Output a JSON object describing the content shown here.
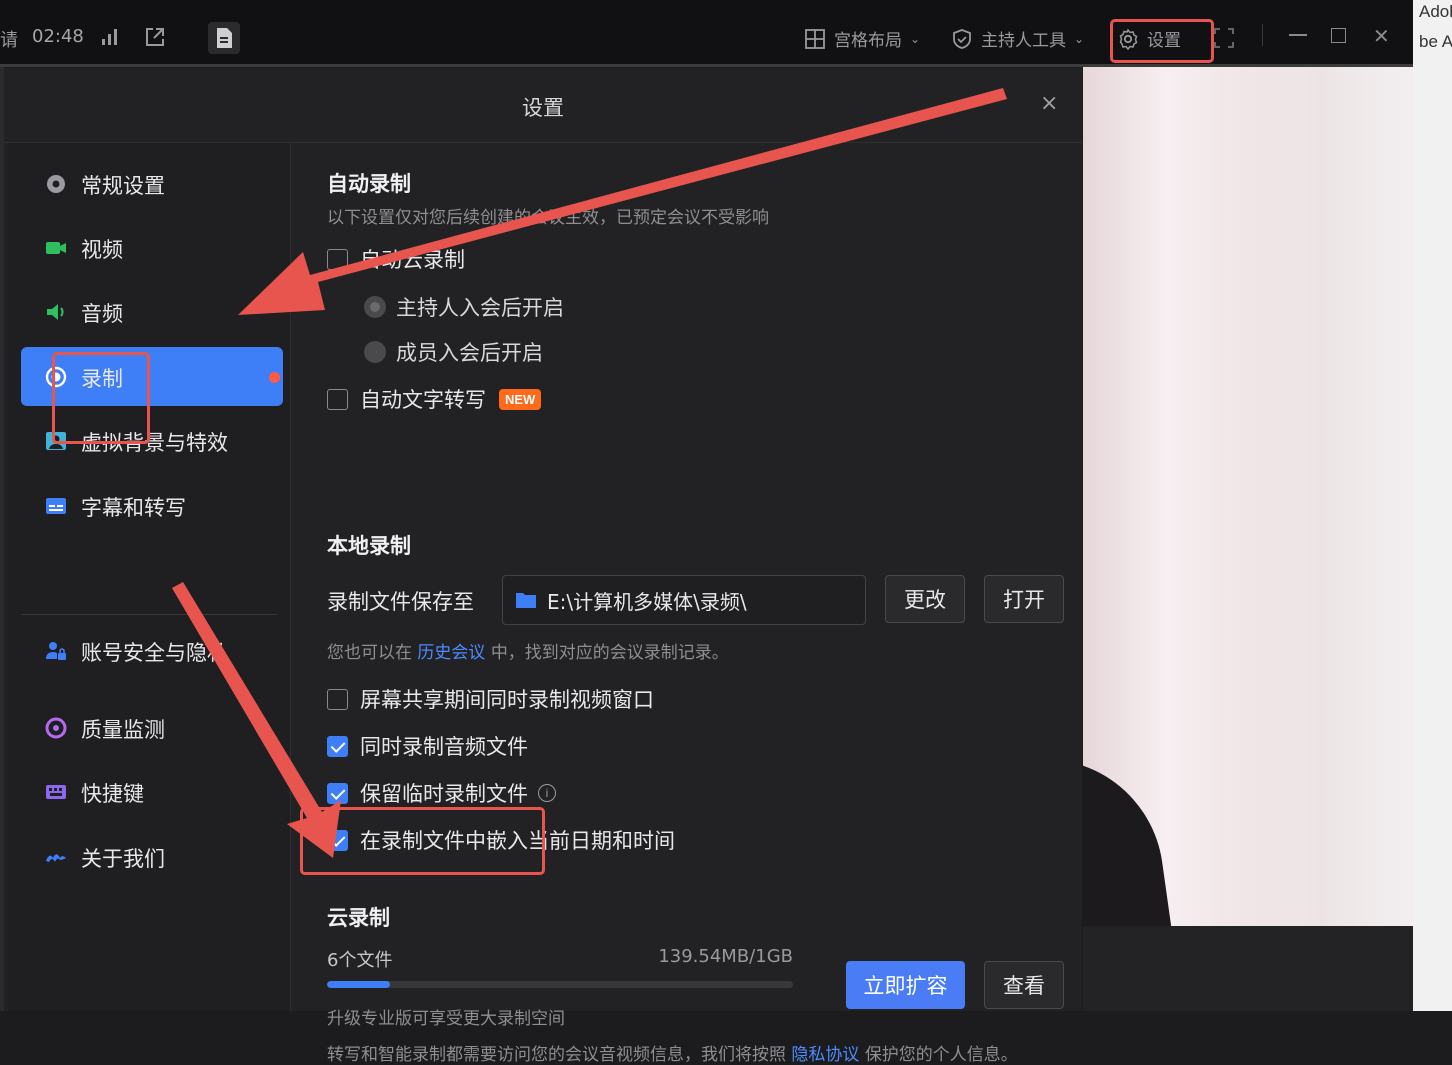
{
  "topbar": {
    "left_char": "请",
    "time": "02:48",
    "grid_layout_label": "宫格布局",
    "host_tools_label": "主持人工具",
    "settings_label": "设置"
  },
  "peek": {
    "right_line1": "Adobe F",
    "right_line2": "be Ac"
  },
  "dialog": {
    "title": "设置",
    "close": "×"
  },
  "sidebar": {
    "items": [
      {
        "label": "常规设置",
        "icon": "gear-icon"
      },
      {
        "label": "视频",
        "icon": "camera-icon"
      },
      {
        "label": "音频",
        "icon": "speaker-icon"
      },
      {
        "label": "录制",
        "icon": "record-icon",
        "active": true
      },
      {
        "label": "虚拟背景与特效",
        "icon": "portrait-icon"
      },
      {
        "label": "字幕和转写",
        "icon": "subtitle-icon"
      },
      {
        "label": "账号安全与隐私",
        "icon": "user-lock-icon"
      },
      {
        "label": "质量监测",
        "icon": "monitor-icon"
      },
      {
        "label": "快捷键",
        "icon": "keyboard-icon"
      },
      {
        "label": "关于我们",
        "icon": "logo-icon"
      }
    ]
  },
  "auto_record": {
    "title": "自动录制",
    "hint": "以下设置仅对您后续创建的会议生效，已预定会议不受影响",
    "auto_record_label": "自动云录制",
    "auto_record_checked": false,
    "radio_host": "主持人入会后开启",
    "radio_member": "成员入会后开启",
    "auto_transcribe_label": "自动文字转写",
    "auto_transcribe_checked": false,
    "new_badge": "NEW"
  },
  "local_record": {
    "title": "本地录制",
    "save_to_label": "录制文件保存至",
    "path": "E:\\计算机多媒体\\录频\\",
    "change_button": "更改",
    "open_button": "打开",
    "history_hint_prefix": "您也可以在",
    "history_link": "历史会议",
    "history_hint_suffix": "中，找到对应的会议录制记录。",
    "options": [
      {
        "label": "屏幕共享期间同时录制视频窗口",
        "checked": false
      },
      {
        "label": "同时录制音频文件",
        "checked": true
      },
      {
        "label": "保留临时录制文件",
        "checked": true,
        "info": "i"
      },
      {
        "label": "在录制文件中嵌入当前日期和时间",
        "checked": true
      }
    ]
  },
  "cloud_record": {
    "title": "云录制",
    "files": "6个文件",
    "usage": "139.54MB/1GB",
    "usage_fraction": 0.136,
    "expand_button": "立即扩容",
    "view_button": "查看",
    "upgrade_hint": "升级专业版可享受更大录制空间",
    "privacy_prefix": "转写和智能录制都需要访问您的会议音视频信息，我们将按照",
    "privacy_link": "隐私协议",
    "privacy_suffix": "保护您的个人信息。"
  },
  "colors": {
    "accent": "#3e7ef7",
    "annotation": "#e8554f",
    "badge": "#ff6a1a",
    "dialog_bg": "#222224"
  }
}
